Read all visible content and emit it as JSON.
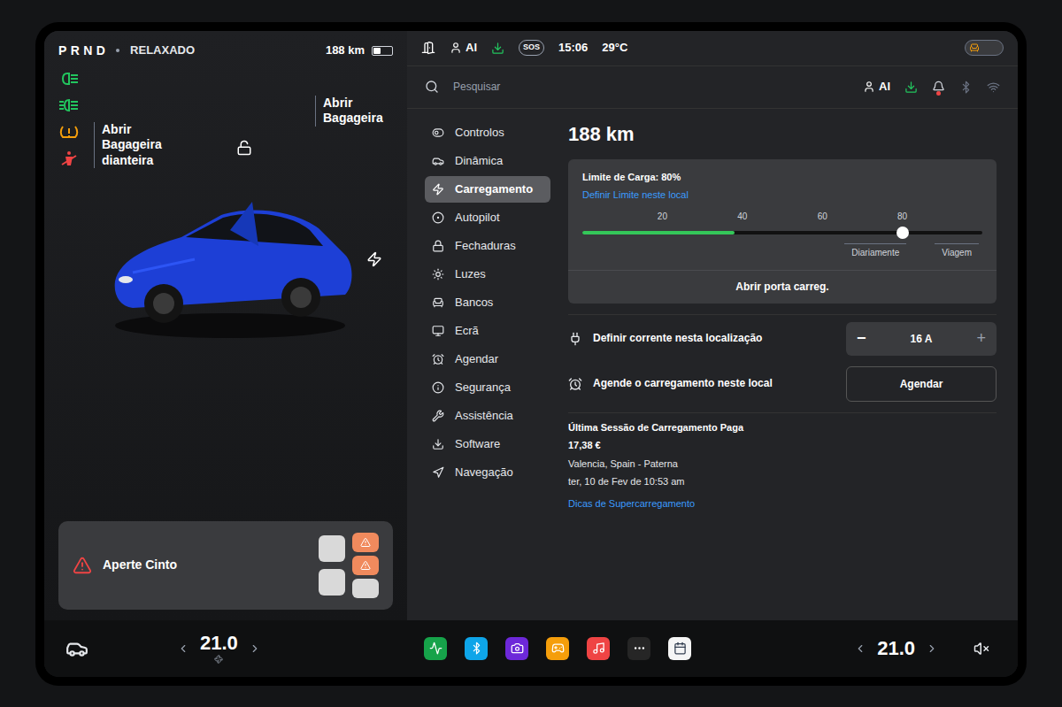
{
  "drive": {
    "gears": [
      "P",
      "R",
      "N",
      "D"
    ],
    "mode": "RELAXADO",
    "range": "188 km",
    "battery_level": 0.38
  },
  "indicators": [
    {
      "kind": "headlight",
      "color": "#22c55e"
    },
    {
      "kind": "fog",
      "color": "#22c55e"
    },
    {
      "kind": "tire",
      "color": "#f59e0b"
    },
    {
      "kind": "seatbelt",
      "color": "#ef4444"
    }
  ],
  "car": {
    "frunk_label": "Abrir Bagageira dianteira",
    "trunk_label": "Abrir Bagageira",
    "locked": false,
    "charging_port": true
  },
  "alert": {
    "text": "Aperte Cinto",
    "seats": [
      {
        "warning": false
      },
      {
        "warning": false
      },
      {
        "warning": true
      },
      {
        "warning": true
      },
      {
        "warning": false
      }
    ]
  },
  "status_bar": {
    "profile": "Al",
    "sos": "SOS",
    "time": "15:06",
    "temperature": "29°C"
  },
  "search": {
    "placeholder": "Pesquisar",
    "profile": "Al",
    "notification": true
  },
  "menu": [
    {
      "label": "Controlos",
      "selected": false
    },
    {
      "label": "Dinâmica",
      "selected": false
    },
    {
      "label": "Carregamento",
      "selected": true
    },
    {
      "label": "Autopilot",
      "selected": false
    },
    {
      "label": "Fechaduras",
      "selected": false
    },
    {
      "label": "Luzes",
      "selected": false
    },
    {
      "label": "Bancos",
      "selected": false
    },
    {
      "label": "Ecrã",
      "selected": false
    },
    {
      "label": "Agendar",
      "selected": false
    },
    {
      "label": "Segurança",
      "selected": false
    },
    {
      "label": "Assistência",
      "selected": false
    },
    {
      "label": "Software",
      "selected": false
    },
    {
      "label": "Navegação",
      "selected": false
    }
  ],
  "charging": {
    "range": "188 km",
    "limit_label": "Limite de Carga: 80%",
    "limit_link": "Definir Limite neste local",
    "ticks": [
      "20",
      "40",
      "60",
      "80"
    ],
    "charge_level": 0.38,
    "level": 0.8,
    "zones": [
      "Diariamente",
      "Viagem"
    ],
    "port_button": "Abrir porta carreg.",
    "current_label": "Definir corrente nesta localização",
    "current_minus": "−",
    "current_value": "16 A",
    "current_plus": "+",
    "schedule_label": "Agende o carregamento neste local",
    "schedule_button": "Agendar",
    "last_session_title": "Última Sessão de Carregamento Paga",
    "last_session_price": "17,38 €",
    "last_session_place": "Valencia, Spain - Paterna",
    "last_session_date": "ter, 10 de Fev de 10:53 am",
    "tips_link": "Dicas de Supercarregamento"
  },
  "climate": {
    "left": "21.0",
    "right": "21.0"
  },
  "dock": [
    {
      "color": "#16a34a"
    },
    {
      "color": "#0ea5e9"
    },
    {
      "color": "#6d28d9"
    },
    {
      "color": "#f59e0b"
    },
    {
      "color": "#ef4444"
    },
    {
      "color": "#262626"
    },
    {
      "color": "#f5f5f5"
    }
  ],
  "volume": {
    "muted": true
  }
}
